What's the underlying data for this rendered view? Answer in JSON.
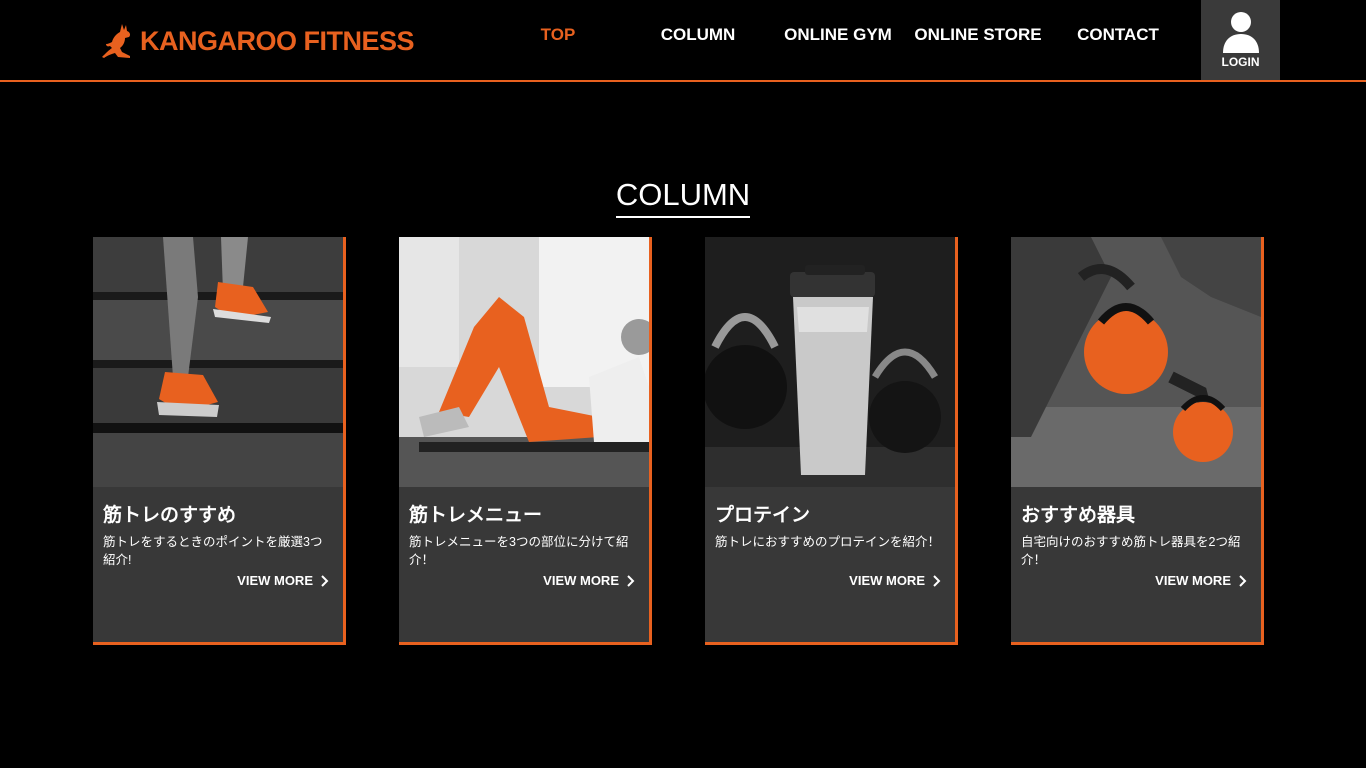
{
  "brand": {
    "name": "KANGAROO FITNESS",
    "accent": "#e8611f"
  },
  "nav": [
    {
      "label": "TOP",
      "active": true
    },
    {
      "label": "COLUMN",
      "active": false
    },
    {
      "label": "ONLINE GYM",
      "active": false
    },
    {
      "label": "ONLINE STORE",
      "active": false
    },
    {
      "label": "CONTACT",
      "active": false
    }
  ],
  "login": {
    "label": "LOGIN",
    "icon": "user-icon"
  },
  "section": {
    "title": "COLUMN"
  },
  "cards": [
    {
      "title": "筋トレのすすめ",
      "desc": "筋トレをするときのポイントを厳選3つ紹介!",
      "link": "VIEW MORE",
      "image": "stairs-running-shoes"
    },
    {
      "title": "筋トレメニュー",
      "desc": "筋トレメニューを3つの部位に分けて紹介！",
      "link": "VIEW MORE",
      "image": "floor-exercise"
    },
    {
      "title": "プロテイン",
      "desc": "筋トレにおすすめのプロテインを紹介！",
      "link": "VIEW MORE",
      "image": "protein-shaker"
    },
    {
      "title": "おすすめ器具",
      "desc": "自宅向けのおすすめ筋トレ器具を2つ紹介！",
      "link": "VIEW MORE",
      "image": "kettlebells"
    }
  ]
}
